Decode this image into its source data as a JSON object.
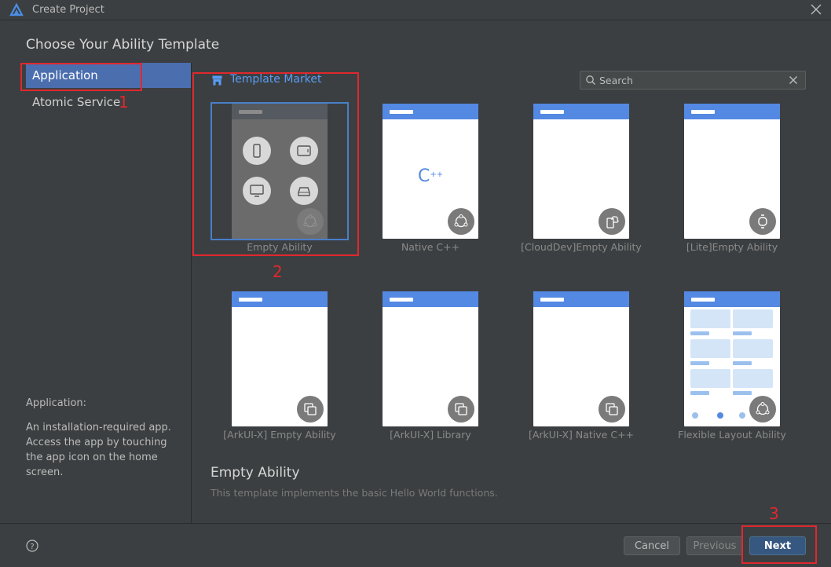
{
  "window": {
    "title": "Create Project"
  },
  "heading": "Choose Your Ability Template",
  "sidebar": {
    "items": [
      {
        "label": "Application",
        "active": true
      },
      {
        "label": "Atomic Service",
        "active": false
      }
    ],
    "description_title": "Application:",
    "description_body": "An installation-required app. Access the app by touching the app icon on the home screen."
  },
  "market": {
    "label": "Template Market"
  },
  "search": {
    "placeholder": "Search"
  },
  "templates": [
    {
      "label": "Empty Ability",
      "selected": true
    },
    {
      "label": "Native C++"
    },
    {
      "label": "[CloudDev]Empty Ability"
    },
    {
      "label": "[Lite]Empty Ability"
    },
    {
      "label": "[ArkUI-X] Empty Ability"
    },
    {
      "label": "[ArkUI-X] Library"
    },
    {
      "label": "[ArkUI-X] Native C++"
    },
    {
      "label": "Flexible Layout Ability"
    }
  ],
  "native_logo_text": "C++",
  "detail": {
    "title": "Empty Ability",
    "description": "This template implements the basic Hello World functions."
  },
  "buttons": {
    "cancel": "Cancel",
    "previous": "Previous",
    "next": "Next"
  },
  "annotations": [
    "1",
    "2",
    "3"
  ],
  "colors": {
    "accent": "#4b6eaf",
    "link": "#589df6",
    "card_header": "#5489e3",
    "annotation": "#e0282e"
  }
}
